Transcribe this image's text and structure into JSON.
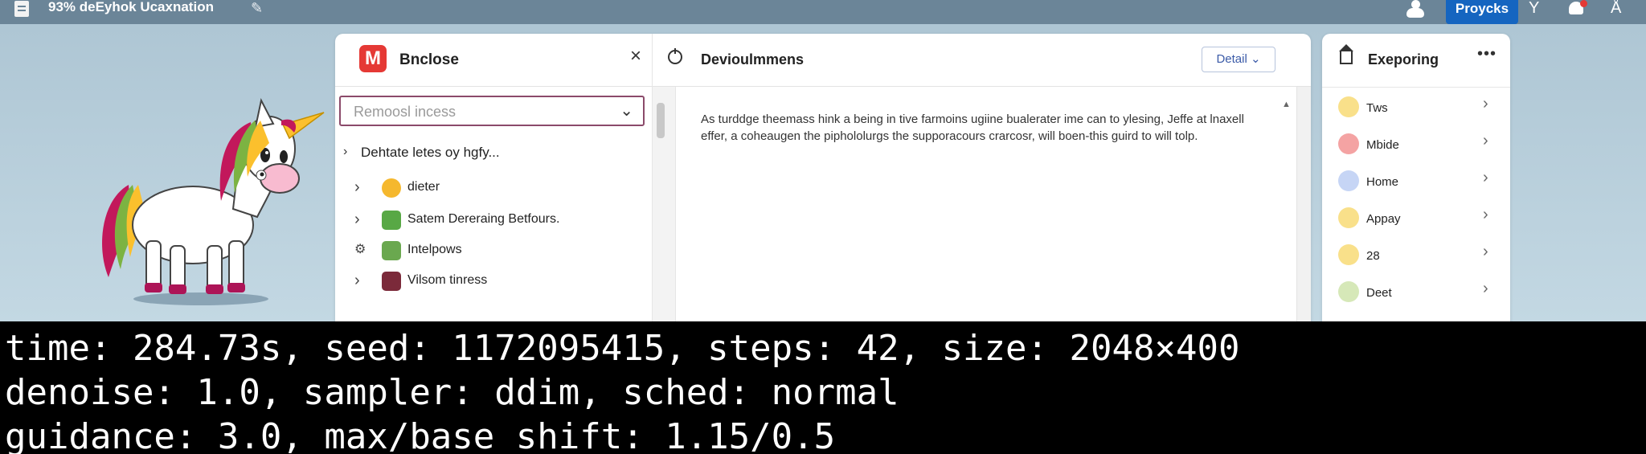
{
  "topbar": {
    "title": "93% deEyhok Ucaxnation",
    "icons": [
      "doc-icon",
      "pen-icon",
      "user-icon",
      "filter-icon",
      "bell-icon",
      "person-icon"
    ],
    "projects_label": "Proycks",
    "colors": {
      "bar": "#6b8598",
      "projects_button": "#1565c0",
      "notification": "#e53935"
    }
  },
  "panel": {
    "title": "Bnclose",
    "section_title": "Devioulmmens",
    "detail_label": "Detail",
    "select_placeholder": "Remoosl incess",
    "tree_root": "Dehtate letes oy hgfy...",
    "tree_items": [
      {
        "label": "dieter",
        "icon": "lemon-icon",
        "color": "#f5b82e"
      },
      {
        "label": "Satem Dereraing Betfours.",
        "icon": "clock-badge-icon",
        "color": "#58a845"
      },
      {
        "label": "Intelpows",
        "icon": "face-badge-icon",
        "color": "#6aa84f"
      },
      {
        "label": "Vilsom tinress",
        "icon": "portrait-badge-icon",
        "color": "#7b2a3a"
      }
    ],
    "content": "As turddge theemass hink a being in tive farmoins ugiine bualerater ime can to ylesing, Jeffe at lnaxell effer, a coheaugen the piphololurgs the supporacours crarcosr, will boen-this guird to will tolp."
  },
  "right_panel": {
    "title": "Exeporing",
    "items": [
      {
        "label": "Tws",
        "color": "#f9e08a"
      },
      {
        "label": "Mbide",
        "color": "#f4a3a3"
      },
      {
        "label": "Home",
        "color": "#c6d5f5"
      },
      {
        "label": "Appay",
        "color": "#f9e08a"
      },
      {
        "label": "28",
        "color": "#f9e08a"
      },
      {
        "label": "Deet",
        "color": "#d6e8b8"
      }
    ]
  },
  "caption": {
    "line1": "time: 284.73s, seed: 1172095415, steps: 42, size: 2048×400",
    "line2": "denoise: 1.0, sampler: ddim, sched: normal",
    "line3": "guidance: 3.0, max/base shift: 1.15/0.5"
  }
}
